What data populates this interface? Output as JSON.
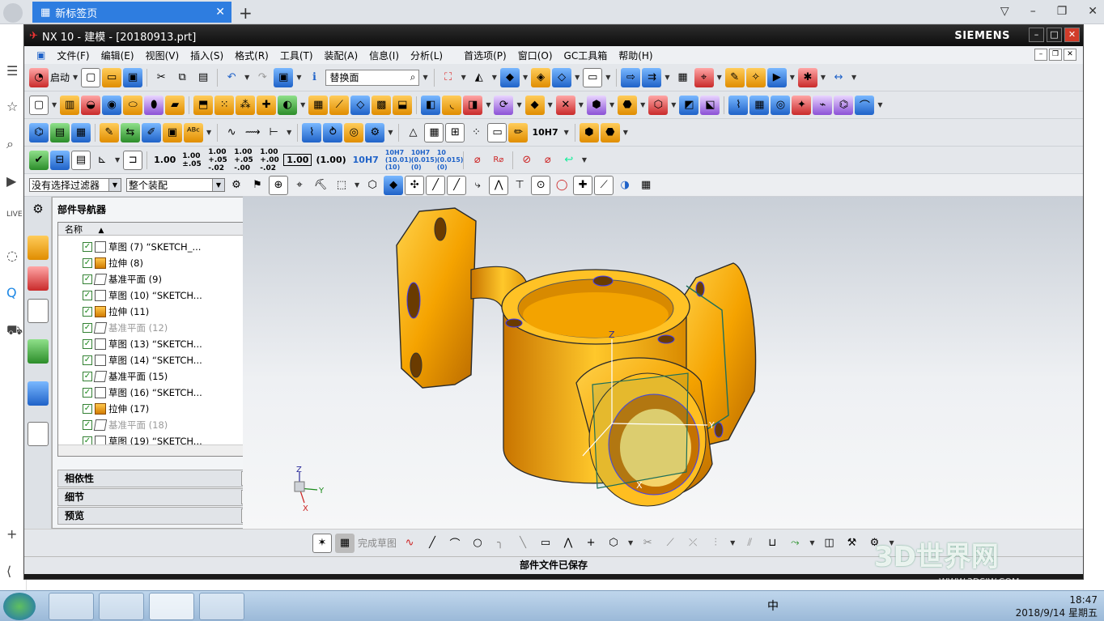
{
  "browser": {
    "tab_title": "新标签页",
    "new_tab": "+",
    "controls": [
      "▽",
      "–",
      "❐",
      "✕"
    ]
  },
  "window": {
    "title": "NX 10 - 建模 - [20180913.prt]",
    "brand": "SIEMENS"
  },
  "menu": [
    "文件(F)",
    "编辑(E)",
    "视图(V)",
    "插入(S)",
    "格式(R)",
    "工具(T)",
    "装配(A)",
    "信息(I)",
    "分析(L)",
    "首选项(P)",
    "窗口(O)",
    "GC工具箱",
    "帮助(H)"
  ],
  "toolbar": {
    "start_label": "启动",
    "search_value": "替换面"
  },
  "dims": [
    "1.00",
    "1.00 ±.05",
    "1.00 +.05 -.02",
    "1.00 +.05 -.00",
    "1.00 +.00 -.02",
    "1.00",
    "(1.00)",
    "10H7",
    "10H7 (10.01)(10)",
    "10H7 (0.015)(0)",
    "10 (0.015)(0)"
  ],
  "filter": {
    "type_filter": "没有选择过滤器",
    "scope": "整个装配"
  },
  "navigator": {
    "title": "部件导航器",
    "column": "名称",
    "rows": [
      {
        "label": "草图 (7) “SKETCH_...",
        "icon": "sketch",
        "greyed": false
      },
      {
        "label": "拉伸 (8)",
        "icon": "extrude",
        "greyed": false
      },
      {
        "label": "基准平面 (9)",
        "icon": "datum",
        "greyed": false
      },
      {
        "label": "草图 (10) “SKETCH...",
        "icon": "sketch",
        "greyed": false
      },
      {
        "label": "拉伸 (11)",
        "icon": "extrude",
        "greyed": false
      },
      {
        "label": "基准平面 (12)",
        "icon": "datum",
        "greyed": true
      },
      {
        "label": "草图 (13) “SKETCH...",
        "icon": "sketch",
        "greyed": false
      },
      {
        "label": "草图 (14) “SKETCH...",
        "icon": "sketch",
        "greyed": false
      },
      {
        "label": "基准平面 (15)",
        "icon": "datum",
        "greyed": false
      },
      {
        "label": "草图 (16) “SKETCH...",
        "icon": "sketch",
        "greyed": false
      },
      {
        "label": "拉伸 (17)",
        "icon": "extrude",
        "greyed": false
      },
      {
        "label": "基准平面 (18)",
        "icon": "datum",
        "greyed": true
      },
      {
        "label": "草图 (19) “SKETCH...",
        "icon": "sketch",
        "greyed": false
      }
    ],
    "sections": [
      "相依性",
      "细节",
      "预览"
    ]
  },
  "sketch_toolbar": {
    "finish_label": "完成草图"
  },
  "status": "部件文件已保存",
  "csys": {
    "z": "Z",
    "y": "Y",
    "x": "X"
  },
  "tray": {
    "ime": "中",
    "time": "18:47",
    "date": "2018/9/14 星期五"
  },
  "watermark": {
    "logo": "3D世界网",
    "url": "WWW.3DSJW.COM"
  }
}
